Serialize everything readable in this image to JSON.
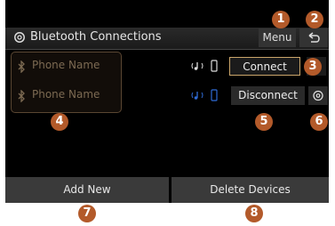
{
  "header": {
    "title": "Bluetooth Connections",
    "menu_label": "Menu"
  },
  "devices": [
    {
      "name": "Phone Name",
      "action": "Connect"
    },
    {
      "name": "Phone Name",
      "action": "Disconnect"
    }
  ],
  "footer": {
    "add_new": "Add New",
    "delete_devices": "Delete Devices"
  },
  "callouts": [
    "1",
    "2",
    "3",
    "4",
    "5",
    "6",
    "7",
    "8"
  ],
  "colors": {
    "accent": "#c9a56a",
    "callout": "#b35a2a",
    "active_icon": "#2f6bd6"
  }
}
